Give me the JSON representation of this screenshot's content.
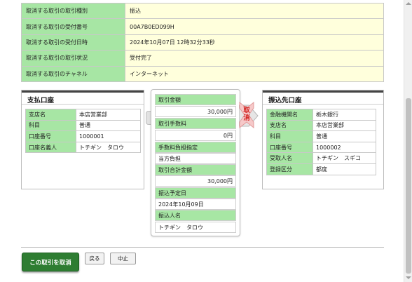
{
  "transaction_info": {
    "rows": [
      {
        "label": "取消する取引の取引種別",
        "value": "振込"
      },
      {
        "label": "取消する取引の受付番号",
        "value": "00A7B0ED099H"
      },
      {
        "label": "取消する取引の受付日時",
        "value": "2024年10月07日 12時32分33秒"
      },
      {
        "label": "取消する取引の取引状況",
        "value": "受付完了"
      },
      {
        "label": "取消する取引のチャネル",
        "value": "インターネット"
      }
    ]
  },
  "payment_account": {
    "title": "支払口座",
    "rows": [
      {
        "label": "支店名",
        "value": "本店営業部"
      },
      {
        "label": "科目",
        "value": "普通"
      },
      {
        "label": "口座番号",
        "value": "1000001"
      },
      {
        "label": "口座名義人",
        "value": "トチギン　タロウ"
      }
    ]
  },
  "transfer_details": {
    "amount_label": "取引金額",
    "amount_value": "30,000円",
    "fee_label": "取引手数料",
    "fee_value": "0円",
    "fee_bearer_label": "手数料負担指定",
    "fee_bearer_value": "当方負担",
    "total_label": "取引合計金額",
    "total_value": "30,000円",
    "scheduled_date_label": "振込予定日",
    "scheduled_date_value": "2024年10月09日",
    "remitter_label": "振込人名",
    "remitter_value": "トチギン　タロウ",
    "cancel_mark": "取消"
  },
  "destination_account": {
    "title": "振込先口座",
    "rows": [
      {
        "label": "金融機関名",
        "value": "栃木銀行"
      },
      {
        "label": "支店名",
        "value": "本店営業部"
      },
      {
        "label": "科目",
        "value": "普通"
      },
      {
        "label": "口座番号",
        "value": "1000002"
      },
      {
        "label": "受取人名",
        "value": "トチギン　スギコ"
      },
      {
        "label": "登録区分",
        "value": "都度"
      }
    ]
  },
  "actions": {
    "cancel_transaction_label": "この取引を取消",
    "back_label": "戻る",
    "stop_label": "中止"
  },
  "colors": {
    "label_bg": "#a7e6a4",
    "value_bg": "#ffffdc",
    "primary_button": "#2e7d32",
    "cancel_mark": "#d0211f"
  }
}
